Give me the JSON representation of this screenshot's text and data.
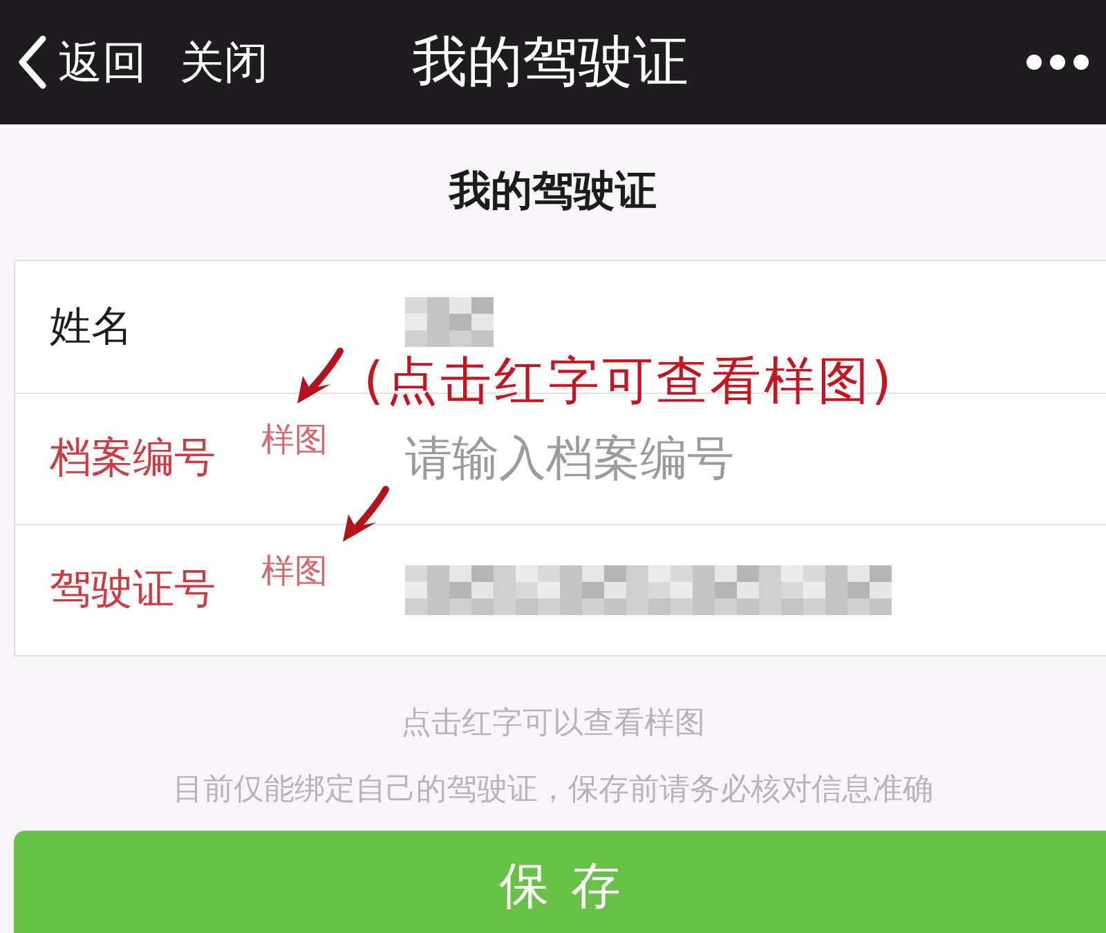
{
  "nav_bar": {
    "back_label": "返回",
    "close_label": "关闭",
    "title": "我的驾驶证"
  },
  "page_title": "我的驾驶证",
  "form_rows": [
    {
      "label": "姓名",
      "highlighted": false,
      "kind": "redacted",
      "long_value": false
    },
    {
      "label": "档案编号",
      "highlighted": true,
      "sample_link": "样图",
      "kind": "input",
      "placeholder": "请输入档案编号"
    },
    {
      "label": "驾驶证号",
      "highlighted": true,
      "sample_link": "样图",
      "kind": "redacted",
      "long_value": true
    }
  ],
  "annotation": {
    "text": "(点击红字可查看样图)"
  },
  "hints": [
    "点击红字可以查看样图",
    "目前仅能绑定自己的驾驶证，保存前请务必核对信息准确"
  ],
  "save_button": {
    "label": "保存"
  }
}
